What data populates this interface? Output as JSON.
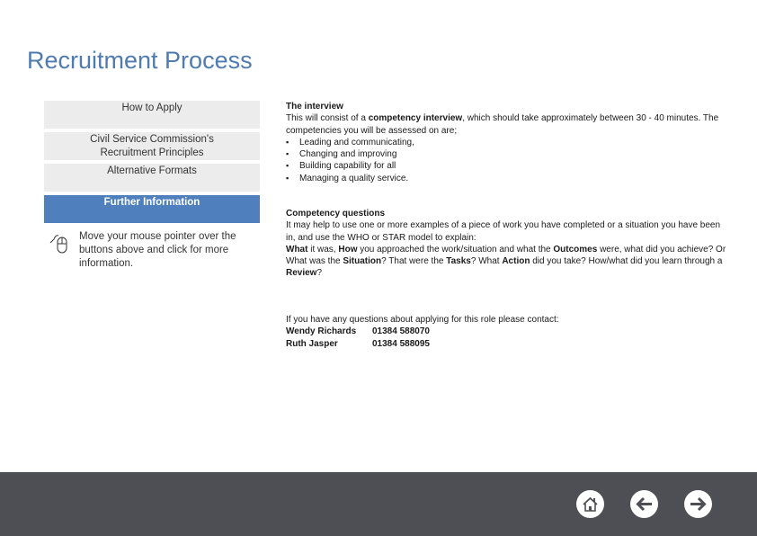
{
  "header": {
    "title": "Recruitment Process"
  },
  "sidebar": {
    "buttons": [
      {
        "label": "How to Apply",
        "active": false
      },
      {
        "label": "Civil Service Commission's Recruitment Principles",
        "active": false
      },
      {
        "label": "Alternative Formats",
        "active": false
      },
      {
        "label": "Further Information",
        "active": true
      }
    ],
    "hint": {
      "icon": "mouse-icon",
      "text": "Move your mouse pointer over the buttons above and click for more information."
    }
  },
  "main": {
    "interview": {
      "heading": "The interview",
      "intro_pre": "This will consist of a ",
      "intro_bold": "competency interview",
      "intro_post": ", which should take approximately between 30 - 40 minutes. The competencies you will be assessed on are;",
      "competencies": [
        "Leading and communicating,",
        "Changing and improving",
        "Building capability for all",
        "Managing a quality service."
      ]
    },
    "questions": {
      "heading": "Competency questions",
      "intro": "It may help to use one or more examples of a piece of work you have completed or a situation you have been in, and use the WHO or STAR model to explain:",
      "parts": [
        {
          "bold": "What",
          "text": " it was, "
        },
        {
          "bold": "How",
          "text": " you approached the work/situation and what the "
        },
        {
          "bold": "Outcomes",
          "text": " were, what did you achieve? Or What was the "
        },
        {
          "bold": "Situation",
          "text": "? That were the "
        },
        {
          "bold": "Tasks",
          "text": "? What "
        },
        {
          "bold": "Action",
          "text": " did you take? How/what did you learn through a "
        },
        {
          "bold": "Review",
          "text": "?"
        }
      ]
    },
    "contact": {
      "intro": "If you have any questions about applying for this role please contact:",
      "people": [
        {
          "name": "Wendy Richards",
          "phone": "01384 588070"
        },
        {
          "name": "Ruth Jasper",
          "phone": "01384 588095"
        }
      ]
    }
  },
  "footer": {
    "background": "#4e4f55",
    "buttons": [
      {
        "icon": "home-icon"
      },
      {
        "icon": "arrow-left-icon"
      },
      {
        "icon": "arrow-right-icon"
      }
    ]
  },
  "colors": {
    "accent": "#4f80bd",
    "title": "#4f7bb0",
    "button_bg": "#ececec"
  }
}
